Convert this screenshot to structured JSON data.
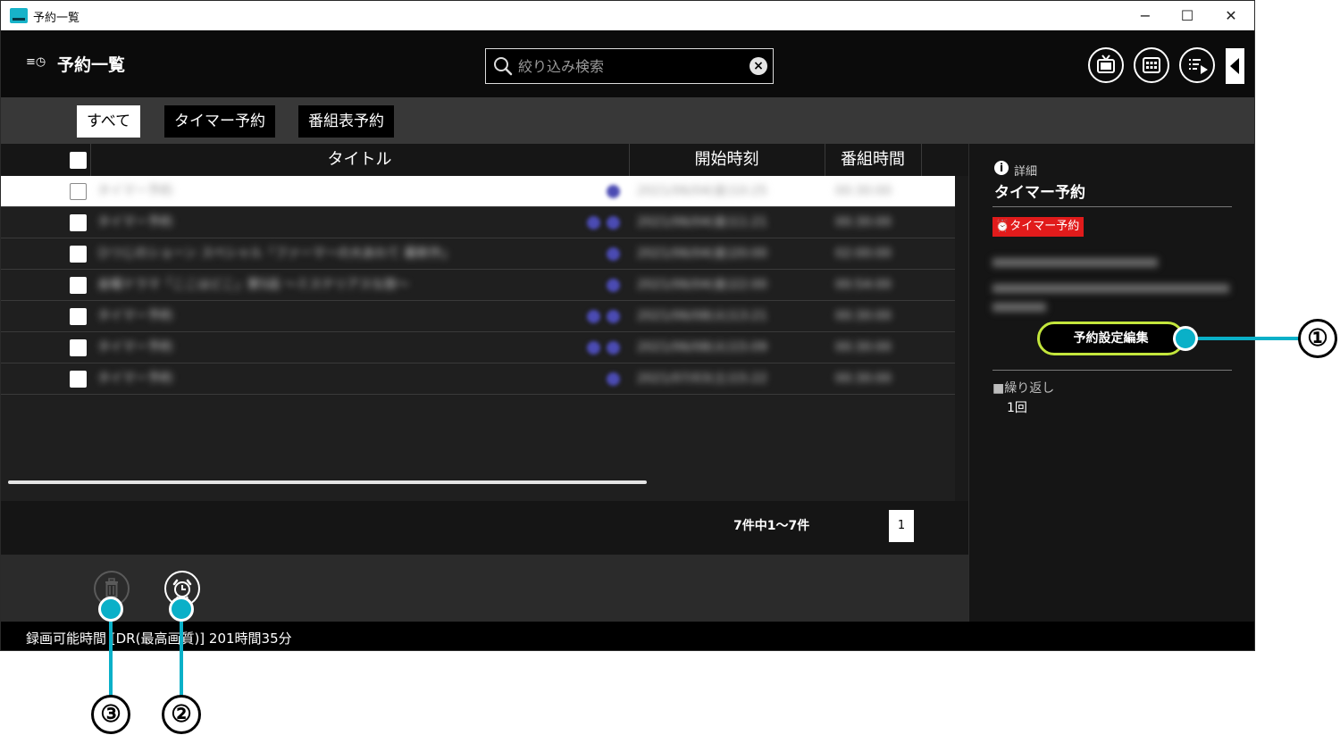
{
  "window": {
    "title": "予約一覧",
    "minimize": "−",
    "maximize": "☐",
    "close": "✕"
  },
  "header": {
    "title": "予約一覧",
    "menu_icon": "≡◷",
    "search_placeholder": "絞り込み検索",
    "icons": [
      "tv-icon",
      "guide-icon",
      "playlist-icon"
    ]
  },
  "tabs": [
    "すべて",
    "タイマー予約",
    "番組表予約"
  ],
  "table": {
    "columns": [
      "タイトル",
      "開始時刻",
      "番組時間"
    ],
    "rows": [
      {
        "title": "タイマー予約",
        "start": "2021/06/04(金)10:25",
        "duration": "00:30:00",
        "selected": true
      },
      {
        "title": "タイマー予約",
        "start": "2021/06/04(金)11:21",
        "duration": "00:30:00",
        "selected": false
      },
      {
        "title": "ひつじのショーン スペシャル「ファーマーの大あわて 最新作」",
        "start": "2021/06/04(金)20:00",
        "duration": "02:00:00",
        "selected": false
      },
      {
        "title": "金曜ドラマ「ここはどこ」第5話 〜ミステリアスな旅〜",
        "start": "2021/06/04(金)22:00",
        "duration": "00:54:00",
        "selected": false
      },
      {
        "title": "タイマー予約",
        "start": "2021/06/08(火)13:21",
        "duration": "00:30:00",
        "selected": false
      },
      {
        "title": "タイマー予約",
        "start": "2021/06/08(火)15:09",
        "duration": "00:30:00",
        "selected": false
      },
      {
        "title": "タイマー予約",
        "start": "2021/07/03(土)15:22",
        "duration": "00:30:00",
        "selected": false
      }
    ]
  },
  "pagination": {
    "count_text": "7件中1〜7件",
    "page": "1"
  },
  "status": {
    "text": "録画可能時間 [DR(最高画質)] 201時間35分"
  },
  "detail": {
    "label": "詳細",
    "title": "タイマー予約",
    "badge": "タイマー予約",
    "edit_button": "予約設定編集",
    "repeat_label": "■繰り返し",
    "repeat_value": "1回"
  },
  "callouts": [
    "①",
    "②",
    "③"
  ],
  "colors": {
    "accent": "#0ab0c8",
    "edit_border": "#c3e63c",
    "badge_red": "#e11b1b"
  }
}
